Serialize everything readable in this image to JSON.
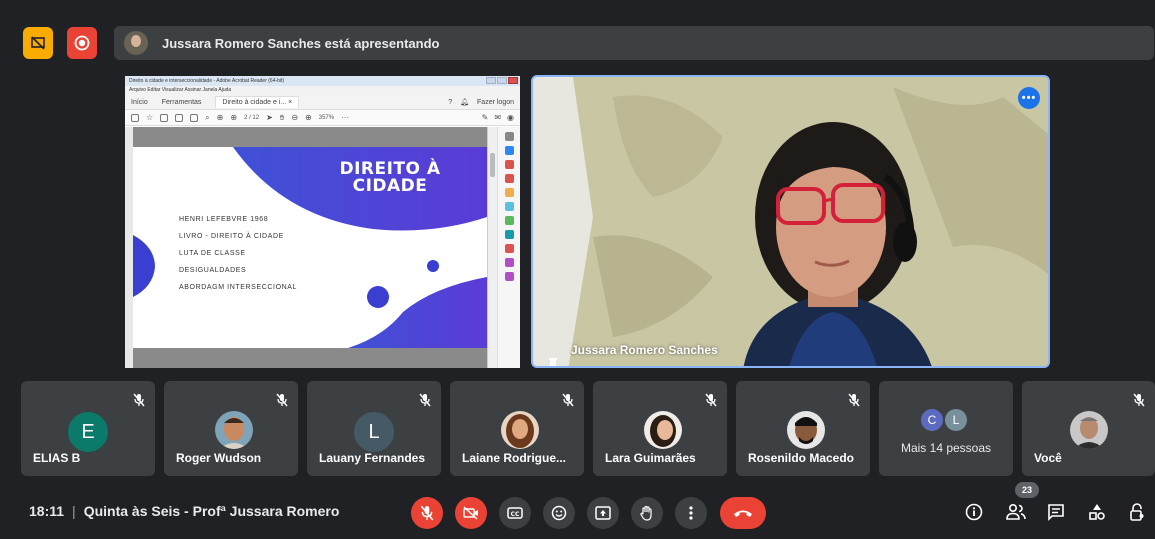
{
  "banner": {
    "presenter_text": "Jussara Romero Sanches está apresentando"
  },
  "acrobat": {
    "window_title": "Direito à cidade e interseccionalidade - Adobe Acrobat Reader (64-bit)",
    "menu": "Arquivo  Editar  Visualizar  Assinar  Janela  Ajuda",
    "tabs": [
      "Início",
      "Ferramentas",
      "Direito à cidade e i...   ×"
    ],
    "login": "Fazer logon",
    "page_indicator": "2 / 12",
    "zoom": "357%"
  },
  "slide": {
    "title_line1": "DIREITO À",
    "title_line2": "CIDADE",
    "items": [
      "HENRI LEFEBVRE 1968",
      "LIVRO - DIREITO À CIDADE",
      "LUTA DE CLASSE",
      "DESIGUALDADES",
      "ABORDAGM INTERSECCIONAL"
    ],
    "accent_color": "#3a3fd1"
  },
  "presenter_tile": {
    "name": "Jussara Romero Sanches",
    "more_label": "•••"
  },
  "participants": [
    {
      "name": "ELIAS B",
      "initial": "E",
      "color": "#0b7a6b"
    },
    {
      "name": "Roger Wudson"
    },
    {
      "name": "Lauany Fernandes",
      "initial": "L",
      "color": "#455a64"
    },
    {
      "name": "Laiane Rodrigue..."
    },
    {
      "name": "Lara Guimarães"
    },
    {
      "name": "Rosenildo Macedo"
    },
    {
      "more": "Mais 14 pessoas",
      "mini": [
        "C",
        "L"
      ]
    },
    {
      "name": "Você"
    }
  ],
  "bottom": {
    "time": "18:11",
    "meeting_title": "Quinta às Seis - Profª Jussara Romero",
    "participant_count": "23"
  }
}
